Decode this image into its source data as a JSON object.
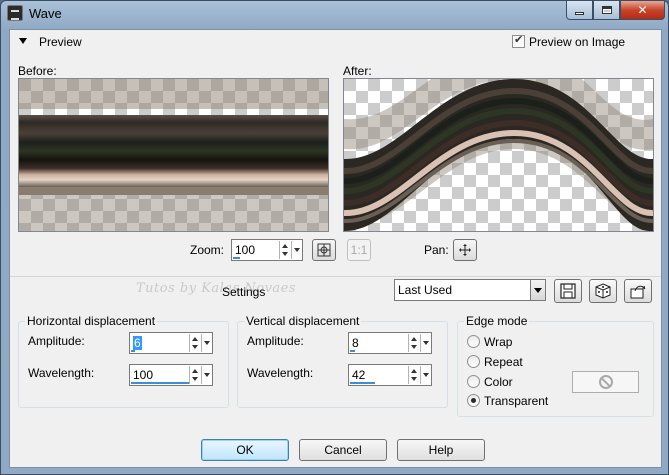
{
  "window": {
    "title": "Wave",
    "close_glyph": "✕"
  },
  "preview": {
    "header": "Preview",
    "preview_on_image": {
      "label": "Preview on Image",
      "checked": true
    },
    "before_label": "Before:",
    "after_label": "After:",
    "zoom_label": "Zoom:",
    "zoom_value": "100",
    "zoom_fill": 0.15,
    "one_to_one_label": "1:1",
    "pan_label": "Pan:"
  },
  "settings": {
    "watermark": "Tutos by Kalas Novaes",
    "label": "Settings",
    "preset_value": "Last Used"
  },
  "horizontal": {
    "title": "Horizontal displacement",
    "amplitude_label": "Amplitude:",
    "amplitude_value": "6",
    "amplitude_fill": 0.06,
    "wavelength_label": "Wavelength:",
    "wavelength_value": "100",
    "wavelength_fill": 1.0
  },
  "vertical": {
    "title": "Vertical displacement",
    "amplitude_label": "Amplitude:",
    "amplitude_value": "8",
    "amplitude_fill": 0.08,
    "wavelength_label": "Wavelength:",
    "wavelength_value": "42",
    "wavelength_fill": 0.42
  },
  "edge_mode": {
    "title": "Edge mode",
    "options": [
      {
        "label": "Wrap",
        "checked": false
      },
      {
        "label": "Repeat",
        "checked": false
      },
      {
        "label": "Color",
        "checked": false
      },
      {
        "label": "Transparent",
        "checked": true
      }
    ]
  },
  "buttons": {
    "ok": "OK",
    "cancel": "Cancel",
    "help": "Help"
  },
  "colors": {
    "accent": "#3c8fd6",
    "titlebar": "#a9c0d8",
    "close": "#c6442a"
  }
}
